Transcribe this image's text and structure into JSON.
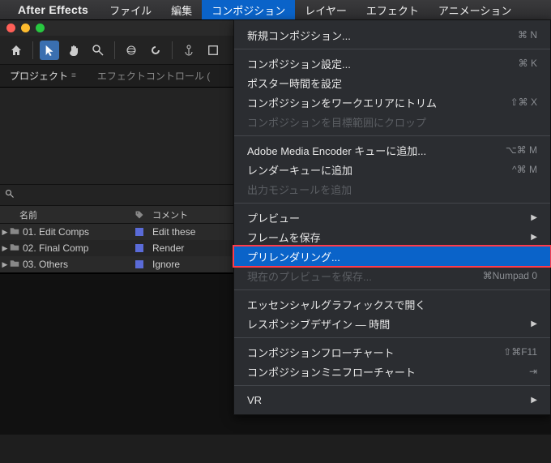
{
  "menubar": {
    "app_name": "After Effects",
    "items": [
      "ファイル",
      "編集",
      "コンポジション",
      "レイヤー",
      "エフェクト",
      "アニメーション"
    ],
    "active_index": 2
  },
  "panel_tabs": {
    "project": "プロジェクト",
    "effect_controls": "エフェクトコントロール ("
  },
  "search": {
    "placeholder": ""
  },
  "list": {
    "headers": {
      "name": "名前",
      "comment": "コメント"
    },
    "rows": [
      {
        "name": "01. Edit Comps",
        "comment": "Edit these"
      },
      {
        "name": "02. Final Comp",
        "comment": "Render"
      },
      {
        "name": "03. Others",
        "comment": "Ignore"
      }
    ]
  },
  "menu": {
    "groups": [
      [
        {
          "label": "新規コンポジション...",
          "shortcut": "⌘ N"
        }
      ],
      [
        {
          "label": "コンポジション設定...",
          "shortcut": "⌘ K"
        },
        {
          "label": "ポスター時間を設定"
        },
        {
          "label": "コンポジションをワークエリアにトリム",
          "shortcut": "⇧⌘ X"
        },
        {
          "label": "コンポジションを目標範囲にクロップ",
          "disabled": true
        }
      ],
      [
        {
          "label": "Adobe Media Encoder キューに追加...",
          "shortcut": "⌥⌘ M"
        },
        {
          "label": "レンダーキューに追加",
          "shortcut": "^⌘ M"
        },
        {
          "label": "出力モジュールを追加",
          "disabled": true
        }
      ],
      [
        {
          "label": "プレビュー",
          "submenu": true
        },
        {
          "label": "フレームを保存",
          "submenu": true
        },
        {
          "label": "プリレンダリング...",
          "highlight": true
        },
        {
          "label": "現在のプレビューを保存...",
          "shortcut": "⌘Numpad 0",
          "disabled": true
        }
      ],
      [
        {
          "label": "エッセンシャルグラフィックスで開く"
        },
        {
          "label": "レスポンシブデザイン — 時間",
          "submenu": true
        }
      ],
      [
        {
          "label": "コンポジションフローチャート",
          "shortcut": "⇧⌘F11"
        },
        {
          "label": "コンポジションミニフローチャート",
          "shortcut": "⇥"
        }
      ],
      [
        {
          "label": "VR",
          "submenu": true
        }
      ]
    ]
  }
}
